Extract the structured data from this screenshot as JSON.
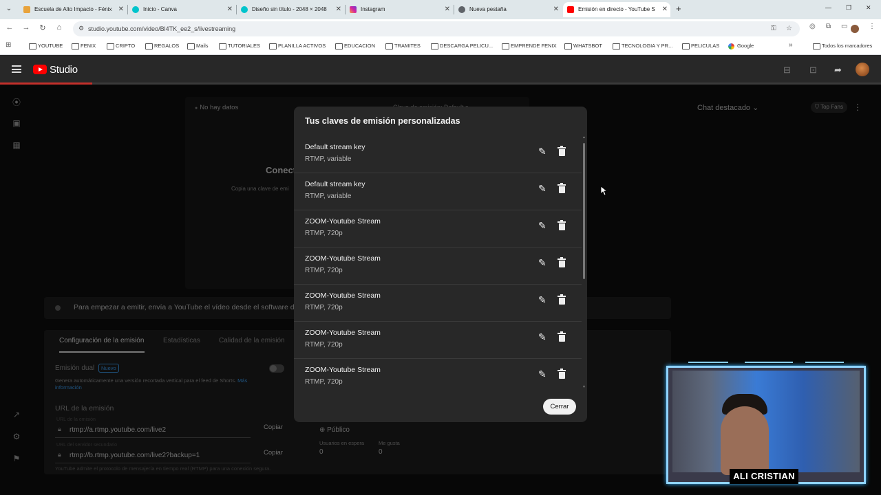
{
  "browser": {
    "tabs": [
      {
        "title": "Escuela de Alto Impacto - Fénix",
        "color": "#e8a33c"
      },
      {
        "title": "Inicio - Canva",
        "color": "#00c4cc"
      },
      {
        "title": "Diseño sin título - 2048 × 2048",
        "color": "#00c4cc"
      },
      {
        "title": "Instagram",
        "color": "#d6249f"
      },
      {
        "title": "Nueva pestaña",
        "color": "#5f6368"
      },
      {
        "title": "Emisión en directo - YouTube S",
        "color": "#ff0000"
      }
    ],
    "url": "studio.youtube.com/video/Bl4TK_ee2_s/livestreaming",
    "bookmarks": [
      "YOUTUBE",
      "FENIX",
      "CRIPTO",
      "REGALOS",
      "Mails",
      "TUTORIALES",
      "PLANILLA ACTIVOS",
      "EDUCACION",
      "TRAMITES",
      "DESCARGA PELICU...",
      "EMPRENDE FENIX",
      "WHATSBOT",
      "TECNOLOGIA Y PR...",
      "PELICULAS",
      "Google"
    ],
    "bookmarks_all": "Todos los marcadores"
  },
  "studio": {
    "logo": "Studio"
  },
  "stream": {
    "no_data": "No hay datos",
    "connect_title": "Conect",
    "connect_hint": "Copia una clave de emi",
    "stream_key_label": "Clave de emisión: Default s...",
    "info_text": "Para empezar a emitir, envía a YouTube el vídeo desde el software de",
    "tabs": [
      "Configuración de la emisión",
      "Estadísticas",
      "Calidad de la emisión"
    ],
    "dual_label": "Emisión dual",
    "dual_badge": "Nuevo",
    "dual_desc": "Genera automáticamente una versión recortada vertical para el feed de Shorts.",
    "more_info": "Más información",
    "url_section": "URL de la emisión",
    "url_label": "URL de la emisión",
    "url_value": "rtmp://a.rtmp.youtube.com/live2",
    "backup_label": "URL del servidor secundario",
    "backup_value": "rtmp://b.rtmp.youtube.com/live2?backup=1",
    "copy": "Copiar",
    "footer": "YouTube admite el protocolo de mensajería en tiempo real (RTMP) para una conexión segura.",
    "visibility": "Público",
    "waiting_label": "Usuarios en espera",
    "waiting_value": "0",
    "likes_label": "Me gusta",
    "likes_value": "0"
  },
  "chat": {
    "header": "Chat destacado",
    "top_fans": "Top Fans"
  },
  "modal": {
    "title": "Tus claves de emisión personalizadas",
    "keys": [
      {
        "name": "Default stream key",
        "detail": "RTMP, variable"
      },
      {
        "name": "Default stream key",
        "detail": "RTMP, variable"
      },
      {
        "name": "ZOOM-Youtube Stream",
        "detail": "RTMP, 720p"
      },
      {
        "name": "ZOOM-Youtube Stream",
        "detail": "RTMP, 720p"
      },
      {
        "name": "ZOOM-Youtube Stream",
        "detail": "RTMP, 720p"
      },
      {
        "name": "ZOOM-Youtube Stream",
        "detail": "RTMP, 720p"
      },
      {
        "name": "ZOOM-Youtube Stream",
        "detail": "RTMP, 720p"
      }
    ],
    "close": "Cerrar"
  },
  "webcam": {
    "name": "ALI CRISTIAN"
  }
}
